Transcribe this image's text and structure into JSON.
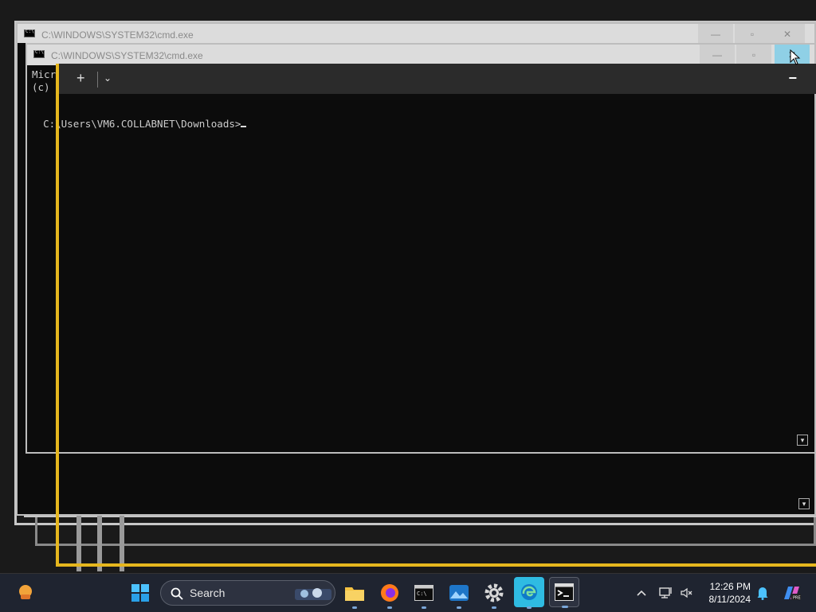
{
  "windows": {
    "back": {
      "title": "C:\\WINDOWS\\SYSTEM32\\cmd.exe"
    },
    "middle": {
      "title": "C:\\WINDOWS\\SYSTEM32\\cmd.exe"
    }
  },
  "terminal": {
    "new_tab": "+",
    "dropdown": "⌄",
    "minimize": "−",
    "header_line1": "Micr",
    "header_line2": "(c)",
    "prompt": "C:\\Users\\VM6.COLLABNET\\Downloads>"
  },
  "taskbar": {
    "search_label": "Search",
    "time": "12:26 PM",
    "date": "8/11/2024",
    "items": [
      {
        "name": "File Explorer"
      },
      {
        "name": "Firefox"
      },
      {
        "name": "Command Prompt"
      },
      {
        "name": "Photos"
      },
      {
        "name": "Settings"
      },
      {
        "name": "Edge"
      },
      {
        "name": "Terminal"
      }
    ]
  },
  "colors": {
    "accent_yellow": "#e6b71e",
    "close_highlight": "#8fd0e6",
    "console_bg": "#0c0c0c",
    "taskbar_bg": "#1f2430"
  }
}
